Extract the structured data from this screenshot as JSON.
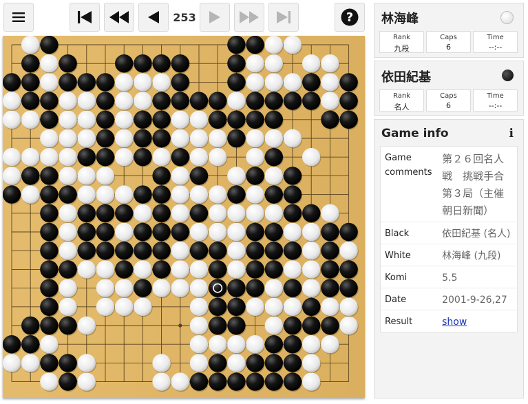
{
  "toolbar": {
    "move_number": "253",
    "buttons": [
      {
        "name": "menu-button",
        "icon": "hamburger-icon",
        "enabled": true
      },
      {
        "name": "first-move-button",
        "icon": "skip-to-start-icon",
        "enabled": true
      },
      {
        "name": "fast-back-button",
        "icon": "fast-rewind-icon",
        "enabled": true
      },
      {
        "name": "back-button",
        "icon": "step-back-icon",
        "enabled": true
      },
      {
        "name": "forward-button",
        "icon": "step-forward-icon",
        "enabled": false
      },
      {
        "name": "fast-forward-button",
        "icon": "fast-forward-icon",
        "enabled": false
      },
      {
        "name": "last-move-button",
        "icon": "skip-to-end-icon",
        "enabled": false
      },
      {
        "name": "help-button",
        "icon": "help-icon",
        "enabled": true
      }
    ]
  },
  "colors": {
    "board": "#e3b763",
    "grid": "#5b4420",
    "button_bg": "#f2f2f2",
    "icon_enabled": "#111111",
    "icon_disabled": "#b5b5b5",
    "link": "#1a35b7"
  },
  "white_player": {
    "name": "林海峰",
    "stats": [
      {
        "label": "Rank",
        "value": "九段"
      },
      {
        "label": "Caps",
        "value": "6"
      },
      {
        "label": "Time",
        "value": "--:--"
      }
    ]
  },
  "black_player": {
    "name": "依田紀基",
    "stats": [
      {
        "label": "Rank",
        "value": "名人"
      },
      {
        "label": "Caps",
        "value": "6"
      },
      {
        "label": "Time",
        "value": "--:--"
      }
    ]
  },
  "game_info": {
    "title": "Game info",
    "info_icon": "info-icon",
    "rows": [
      {
        "key": "Game comments",
        "value": "第２６回名人戦　挑戦手合第３局（主催　朝日新聞）"
      },
      {
        "key": "Black",
        "value": "依田紀基 (名人)"
      },
      {
        "key": "White",
        "value": "林海峰 (九段)"
      },
      {
        "key": "Komi",
        "value": "5.5"
      },
      {
        "key": "Date",
        "value": "2001-9-26,27"
      },
      {
        "key": "Result",
        "value": "show",
        "link": true
      }
    ]
  },
  "board": {
    "size": 19,
    "last_move": [
      13,
      11
    ],
    "rows": [
      ".WB.........BBWW...",
      ".BWB..BBBB..BWW.WW.",
      "BBWBBBWWWB..BWWWBWBW",
      "WBBWWBWWBBBBWBBBBWBW",
      "WWBWWBWBBWWBBBB..BB",
      "..WWWBWBBWWWBWWW...",
      "WWWWBBWBWBWW.WB.W..",
      "WBBWWW..BWB.WBWB...",
      "BWBBWWWBBWWWBWBB...",
      "..BWBBBWBWBWWWWBBW.",
      "..BWBBWBBBWWWBBWWBB.",
      "..BWBBBBBWBBWBBBWBW.",
      "..BBWWBWBWWBWBBWWBBB",
      "..BW.WWBWWWBBBWBWBBB",
      "..BW.WWW..WBBWWWBWWW",
      ".BBBW.....WBB.WBBBWW",
      "BBW.......WWWWBBWW.W",
      "WWBBW...W.WBWBBBW...",
      "..WBW...WWBBBBBBW..."
    ]
  }
}
